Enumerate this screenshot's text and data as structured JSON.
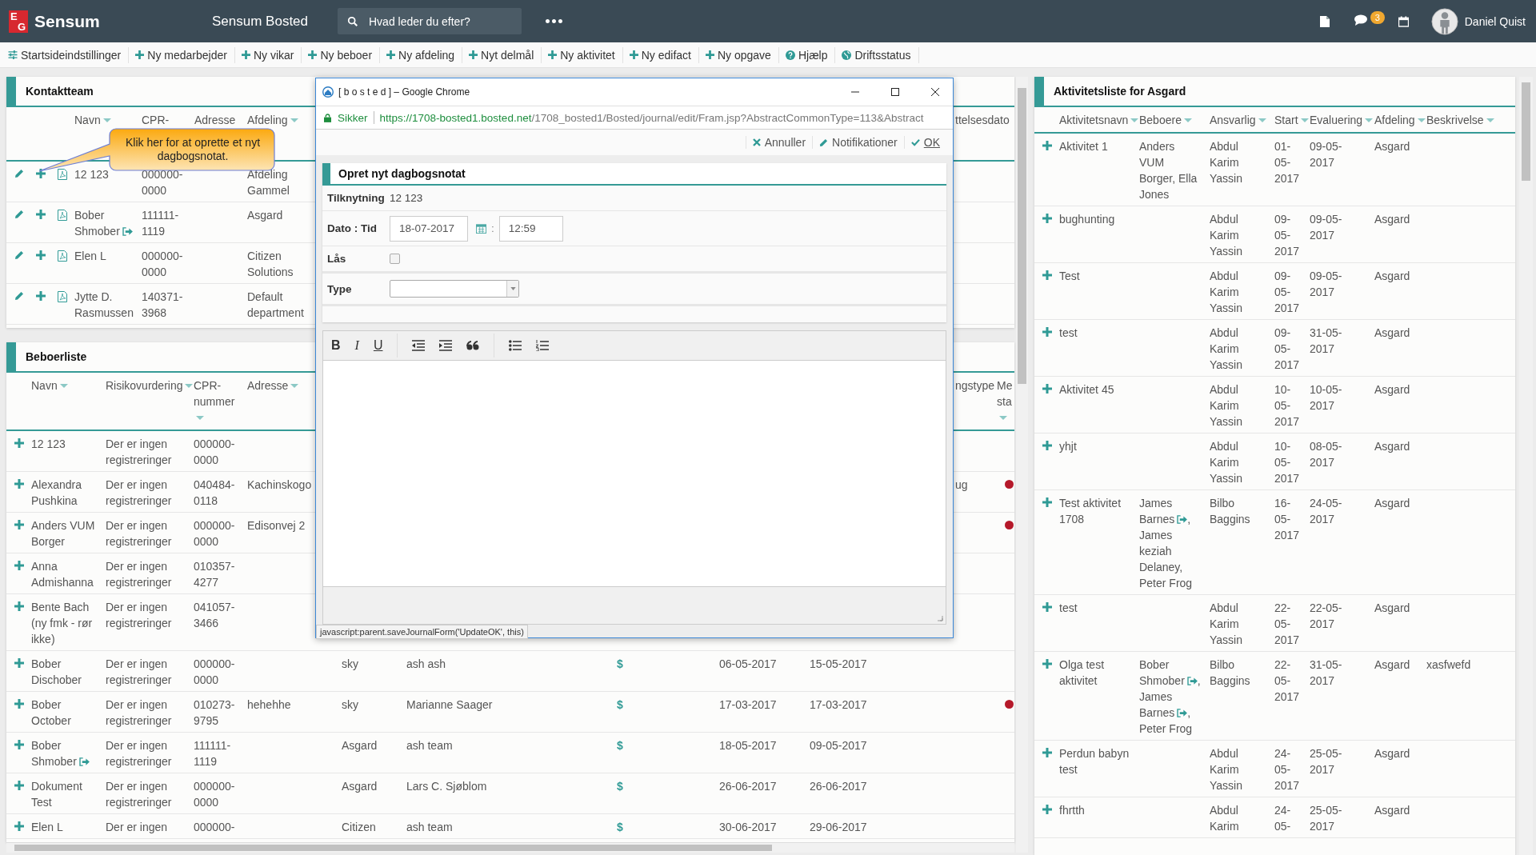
{
  "topbar": {
    "logo_letters": [
      "E",
      "G"
    ],
    "brand": "Sensum",
    "app_title": "Sensum Bosted",
    "search": {
      "placeholder": "Hvad leder du efter?"
    },
    "more": "•••",
    "message_count": "3",
    "user": "Daniel Quist"
  },
  "toolbar": [
    {
      "kind": "settings",
      "label": "Startsideindstillinger"
    },
    {
      "kind": "add",
      "label": "Ny medarbejder"
    },
    {
      "kind": "add",
      "label": "Ny vikar"
    },
    {
      "kind": "add",
      "label": "Ny beboer"
    },
    {
      "kind": "add",
      "label": "Ny afdeling"
    },
    {
      "kind": "add",
      "label": "Nyt delmål"
    },
    {
      "kind": "add",
      "label": "Ny aktivitet"
    },
    {
      "kind": "add",
      "label": "Ny edifact"
    },
    {
      "kind": "add",
      "label": "Ny opgave"
    },
    {
      "kind": "help",
      "label": "Hjælp"
    },
    {
      "kind": "status",
      "label": "Driftsstatus"
    }
  ],
  "contact_team": {
    "title": "Kontaktteam",
    "columns": [
      {
        "label": "Navn",
        "sortable": true
      },
      {
        "label": "CPR-",
        "sortable": false
      },
      {
        "label": "Adresse",
        "sortable": false
      },
      {
        "label": "Afdeling",
        "sortable": true
      },
      {
        "label": "ttelsesdato",
        "sortable": false
      }
    ],
    "rows": [
      {
        "name": "12 123",
        "moved": false,
        "cpr": "000000-0000",
        "department": "Afdeling Gammel"
      },
      {
        "name": "Bober Shmober",
        "moved": true,
        "cpr": "111111-1119",
        "department": "Asgard"
      },
      {
        "name": "Elen L",
        "moved": false,
        "cpr": "000000-0000",
        "department": "Citizen Solutions"
      },
      {
        "name": "Jytte D. Rasmussen",
        "moved": false,
        "cpr": "140371-3968",
        "department": "Default department"
      }
    ]
  },
  "callout": "Klik her for at oprette et nyt dagbogsnotat.",
  "residents": {
    "title": "Beboerliste",
    "columns": [
      {
        "label": "Navn",
        "sortable": true
      },
      {
        "label": "Risikovurdering",
        "sortable": true
      },
      {
        "label": "CPR-nummer",
        "sortable": true
      },
      {
        "label": "Adresse",
        "sortable": true
      },
      {
        "label": "ngstype",
        "sortable": false
      },
      {
        "label": "Me sta",
        "sortable": true
      }
    ],
    "rows": [
      {
        "name": "12 123",
        "moved": false,
        "risk": "Der er ingen registreringer",
        "cpr": "000000-0000",
        "flagged": false
      },
      {
        "name": "Alexandra Pushkina",
        "moved": false,
        "risk": "Der er ingen registreringer",
        "cpr": "040484-0118",
        "address": "Kachinskogo",
        "column_10": "ug",
        "flagged": true
      },
      {
        "name": "Anders VUM Borger",
        "moved": false,
        "risk": "Der er ingen registreringer",
        "cpr": "000000-0000",
        "address": "Edisonvej 2",
        "flagged": true
      },
      {
        "name": "Anna Admishanna",
        "moved": false,
        "risk": "Der er ingen registreringer",
        "cpr": "010357-4277",
        "flagged": false
      },
      {
        "name": "Bente Bach (ny fmk - rør ikke)",
        "moved": false,
        "risk": "Der er ingen registreringer",
        "cpr": "041057-3466",
        "flagged": false
      },
      {
        "name": "Bober Dischober",
        "moved": false,
        "risk": "Der er ingen registreringer",
        "cpr": "000000-0000",
        "column_5": "sky",
        "column_6": "ash ash",
        "column_7": "$",
        "column_8": "06-05-2017",
        "column_9": "15-05-2017",
        "flagged": false
      },
      {
        "name": "Bober October",
        "moved": false,
        "risk": "Der er ingen registreringer",
        "cpr": "010273-9795",
        "address": "hehehhe",
        "column_5": "sky",
        "column_6": "Marianne Saager",
        "column_7": "$",
        "column_8": "17-03-2017",
        "column_9": "17-03-2017",
        "flagged": true
      },
      {
        "name": "Bober Shmober",
        "moved": true,
        "risk": "Der er ingen registreringer",
        "cpr": "111111-1119",
        "column_5": "Asgard",
        "column_6": "ash team",
        "column_7": "$",
        "column_8": "18-05-2017",
        "column_9": "09-05-2017",
        "flagged": false
      },
      {
        "name": "Dokument Test",
        "moved": false,
        "risk": "Der er ingen registreringer",
        "cpr": "000000-0000",
        "column_5": "Asgard",
        "column_6": "Lars C. Sjøblom",
        "column_7": "$",
        "column_8": "26-06-2017",
        "column_9": "26-06-2017",
        "flagged": false
      },
      {
        "name": "Elen L",
        "moved": false,
        "risk": "Der er ingen",
        "cpr": "000000-",
        "column_5": "Citizen",
        "column_6": "ash team",
        "column_7": "$",
        "column_8": "30-06-2017",
        "column_9": "29-06-2017",
        "flagged": false
      }
    ]
  },
  "activities": {
    "title": "Aktivitetsliste for Asgard",
    "resident_separator": ", ",
    "columns": [
      {
        "label": "Aktivitetsnavn",
        "sortable": true
      },
      {
        "label": "Beboere",
        "sortable": true
      },
      {
        "label": "Ansvarlig",
        "sortable": true
      },
      {
        "label": "Start",
        "sortable": true
      },
      {
        "label": "Evaluering",
        "sortable": true
      },
      {
        "label": "Afdeling",
        "sortable": true
      },
      {
        "label": "Beskrivelse",
        "sortable": true
      }
    ],
    "rows": [
      {
        "name": "Aktivitet 1",
        "residents": [
          {
            "name": "Anders VUM Borger",
            "moved": false
          },
          {
            "name": "Ella Jones",
            "moved": false
          }
        ],
        "responsible": "Abdul Karim Yassin",
        "start": "01-05-2017",
        "evaluation": "09-05-2017",
        "department": "Asgard"
      },
      {
        "name": "bughunting",
        "residents": [],
        "responsible": "Abdul Karim Yassin",
        "start": "09-05-2017",
        "evaluation": "09-05-2017",
        "department": "Asgard"
      },
      {
        "name": "Test",
        "residents": [],
        "responsible": "Abdul Karim Yassin",
        "start": "09-05-2017",
        "evaluation": "09-05-2017",
        "department": "Asgard"
      },
      {
        "name": "test",
        "residents": [],
        "responsible": "Abdul Karim Yassin",
        "start": "09-05-2017",
        "evaluation": "31-05-2017",
        "department": "Asgard"
      },
      {
        "name": "Aktivitet 45",
        "residents": [],
        "responsible": "Abdul Karim Yassin",
        "start": "10-05-2017",
        "evaluation": "10-05-2017",
        "department": "Asgard"
      },
      {
        "name": "yhjt",
        "residents": [],
        "responsible": "Abdul Karim Yassin",
        "start": "10-05-2017",
        "evaluation": "08-05-2017",
        "department": "Asgard"
      },
      {
        "name": "Test aktivitet 1708",
        "residents": [
          {
            "name": "James Barnes",
            "moved": true
          },
          {
            "name": "James keziah Delaney",
            "moved": false
          },
          {
            "name": "Peter Frog",
            "moved": false
          }
        ],
        "responsible": "Bilbo Baggins",
        "start": "16-05-2017",
        "evaluation": "24-05-2017",
        "department": "Asgard"
      },
      {
        "name": "test",
        "residents": [],
        "responsible": "Abdul Karim Yassin",
        "start": "22-05-2017",
        "evaluation": "22-05-2017",
        "department": "Asgard"
      },
      {
        "name": "Olga test aktivitet",
        "residents": [
          {
            "name": "Bober Shmober",
            "moved": true
          },
          {
            "name": "James Barnes",
            "moved": true
          },
          {
            "name": "Peter Frog",
            "moved": false
          }
        ],
        "responsible": "Bilbo Baggins",
        "start": "22-05-2017",
        "evaluation": "31-05-2017",
        "department": "Asgard",
        "description": "xasfwefd"
      },
      {
        "name": "Perdun babyn test",
        "residents": [],
        "responsible": "Abdul Karim Yassin",
        "start": "24-05-2017",
        "evaluation": "25-05-2017",
        "department": "Asgard"
      },
      {
        "name": "fhrtth",
        "residents": [],
        "responsible": "Abdul Karim",
        "start": "24-05-",
        "evaluation": "25-05-2017",
        "department": "Asgard"
      }
    ]
  },
  "dialog": {
    "title": "[ b o s t e d ] – Google Chrome",
    "security": "Sikker",
    "url_host": "https://1708-bosted1.bosted.net",
    "url_path": "/1708_bosted1/Bosted/journal/edit/Fram.jsp?AbstractCommonType=113&Abstract",
    "actions": [
      {
        "kind": "cancel",
        "label": "Annuller"
      },
      {
        "kind": "notify",
        "label": "Notifikationer"
      },
      {
        "kind": "ok",
        "label": "OK"
      }
    ],
    "form_title": "Opret nyt dagbogsnotat",
    "link_label": "Tilknytning",
    "link_value": "12 123",
    "datetime_label": "Dato : Tid",
    "date": "18-07-2017",
    "time_separator": ":",
    "time": "12:59",
    "lock_label": "Lås",
    "locked": false,
    "type_label": "Type",
    "editor_tools": [
      {
        "kind": "bold",
        "label": "B"
      },
      {
        "kind": "italic",
        "label": "I"
      },
      {
        "kind": "underline",
        "label": "U"
      },
      {
        "kind": "outdent"
      },
      {
        "kind": "indent"
      },
      {
        "kind": "quote"
      },
      {
        "kind": "bullets"
      },
      {
        "kind": "numbers"
      }
    ],
    "status_text": "javascript:parent.saveJournalForm('UpdateOK', this)"
  }
}
